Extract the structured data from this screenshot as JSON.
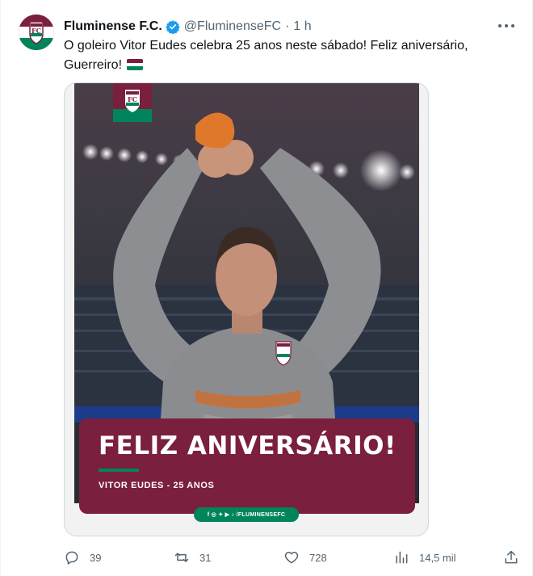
{
  "tweet": {
    "display_name": "Fluminense F.C.",
    "handle": "@FluminenseFC",
    "separator": "·",
    "time": "1 h",
    "text": "O goleiro Vitor Eudes celebra 25 anos neste sábado! Feliz aniversário, Guerreiro!",
    "flag_colors": [
      "#7a1f3d",
      "#ffffff",
      "#00845c"
    ]
  },
  "media": {
    "banner_title": "FELIZ ANIVERSÁRIO!",
    "banner_subtitle": "VITOR EUDES - 25 ANOS",
    "social_tag": "f ◎ ✦ ▶ ♪ /FLUMINENSEFC"
  },
  "actions": {
    "replies": "39",
    "retweets": "31",
    "likes": "728",
    "views": "14,5 mil"
  },
  "icons": {
    "reply": "reply-icon",
    "retweet": "retweet-icon",
    "like": "heart-icon",
    "views": "views-icon",
    "share": "share-icon",
    "verified": "verified-icon",
    "more": "more-icon"
  },
  "colors": {
    "brand_grena": "#7a1f3d",
    "brand_green": "#00845c",
    "verified_blue": "#1d9bf0",
    "muted_text": "#536471"
  }
}
